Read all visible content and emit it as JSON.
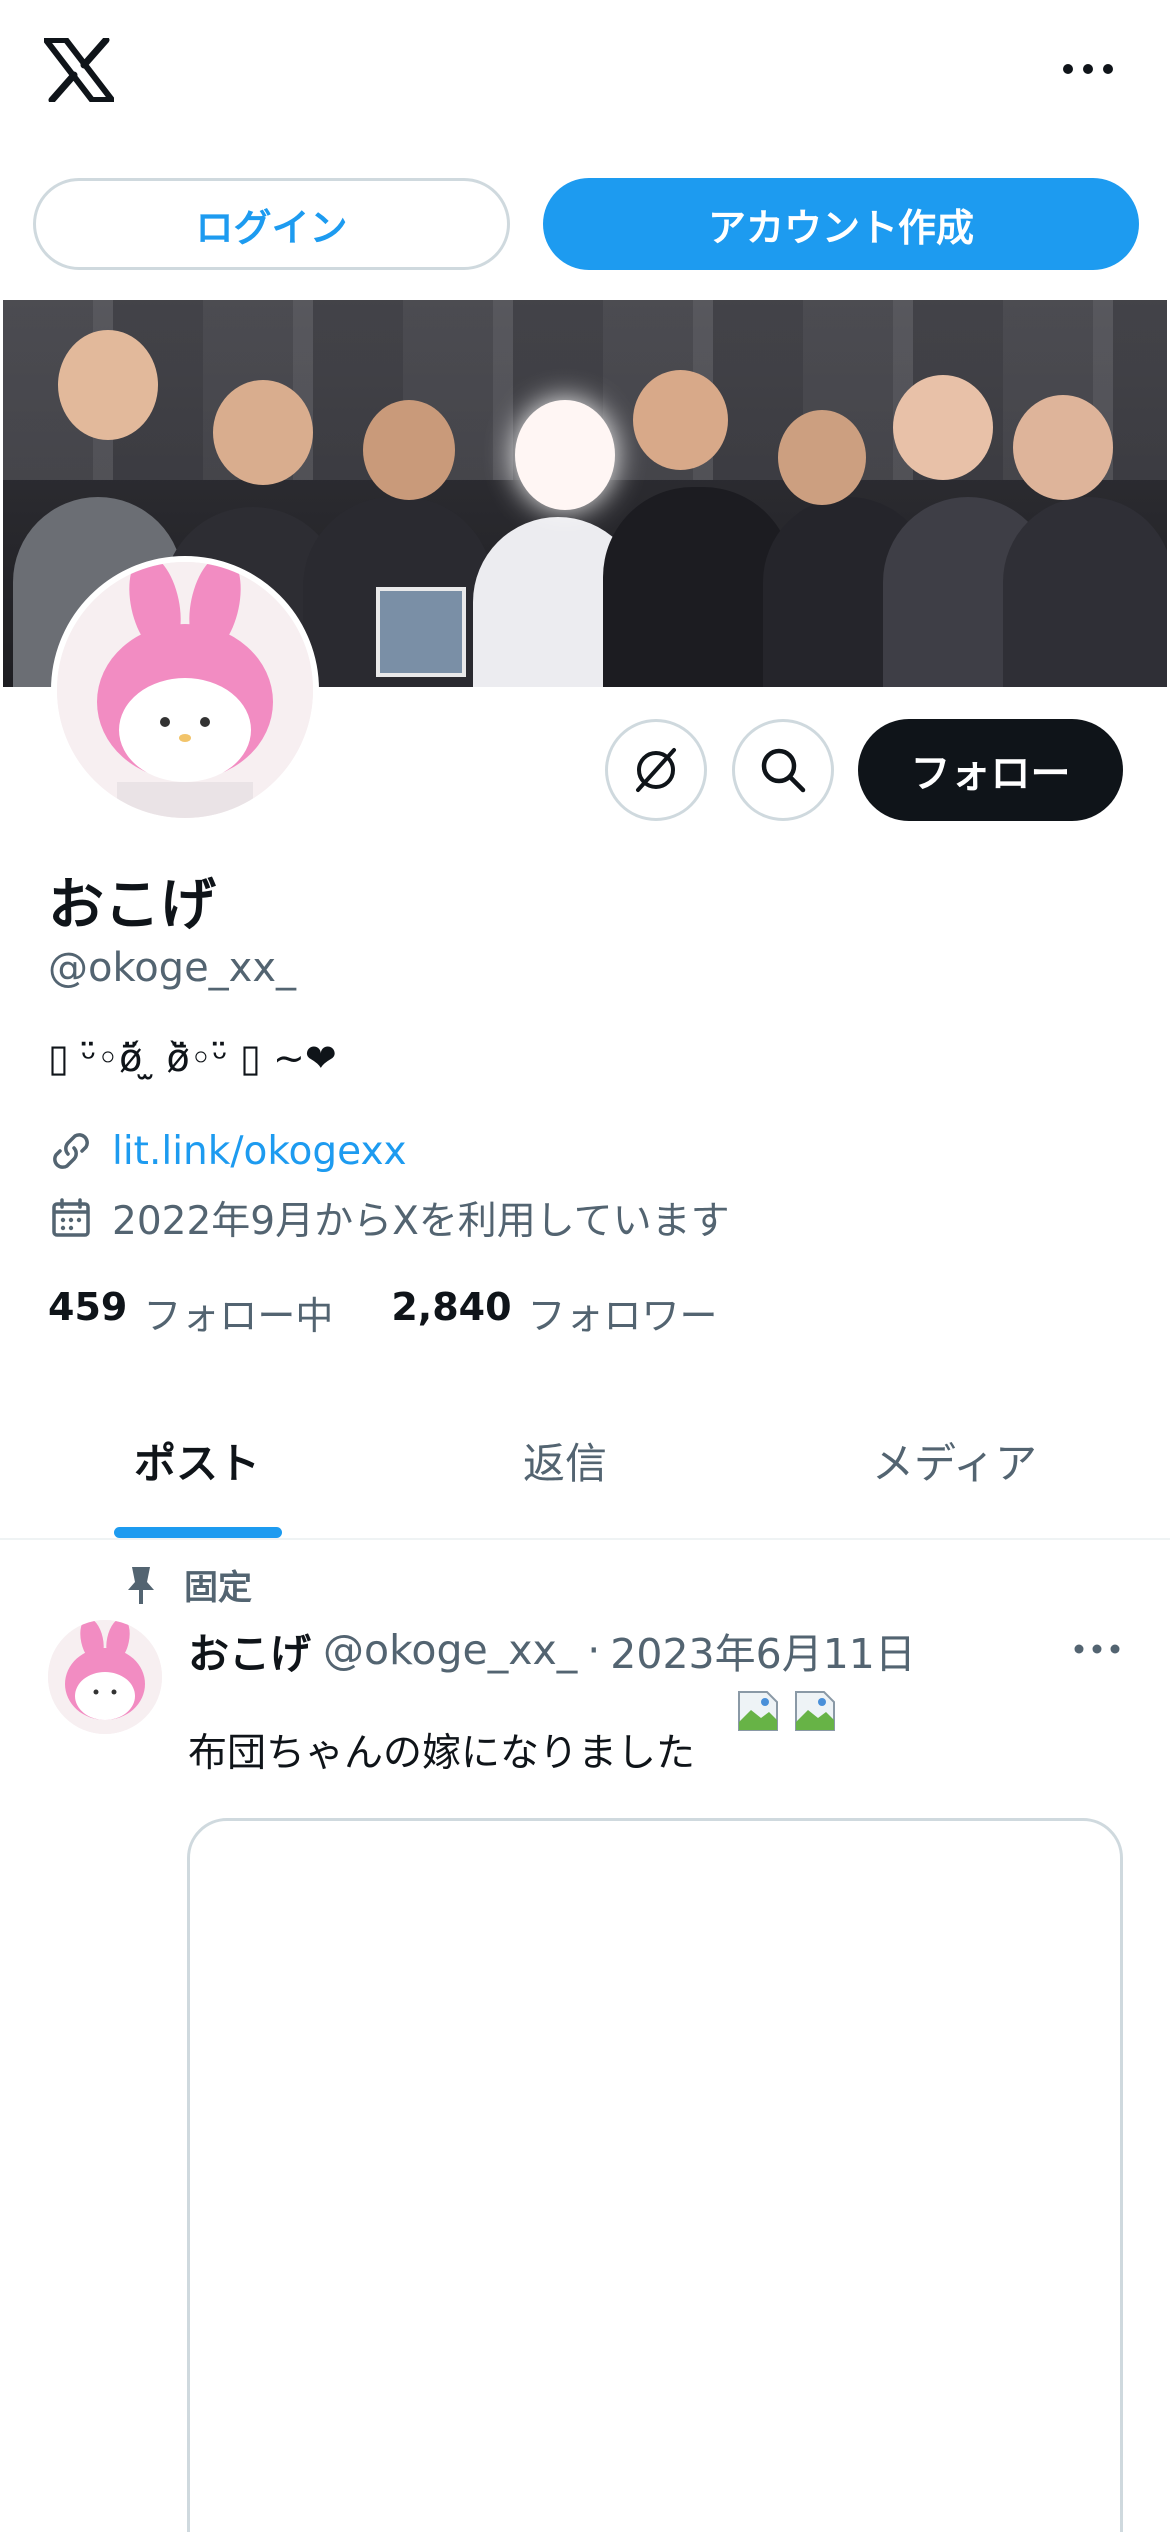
{
  "header": {
    "logo_icon": "x-logo-icon",
    "more_icon": "more-dots-icon"
  },
  "auth": {
    "login_label": "ログイン",
    "signup_label": "アカウント作成"
  },
  "profile": {
    "display_name": "おこげ",
    "handle": "@okoge_xx_",
    "bio": "▯ ᵕ̈◦ø̈᷄ ̫ ø̈᷅◦ᵕ̈ ▯ ~❤",
    "link": "lit.link/okogexx",
    "joined": "2022年9月からXを利用しています",
    "follow_label": "フォロー",
    "following_count": "459",
    "following_label": "フォロー中",
    "followers_count": "2,840",
    "followers_label": "フォロワー"
  },
  "tabs": [
    {
      "label": "ポスト",
      "selected": true
    },
    {
      "label": "返信",
      "selected": false
    },
    {
      "label": "メディア",
      "selected": false
    }
  ],
  "pinned_post": {
    "pinned_label": "固定",
    "author_name": "おこげ",
    "author_handle": "@okoge_xx_",
    "separator": "·",
    "date": "2023年6月11日",
    "text": "布団ちゃんの嫁になりました"
  },
  "colors": {
    "accent": "#1d9bf0",
    "text_primary": "#0f1419",
    "text_secondary": "#536471",
    "border": "#cfd9de",
    "follow_button": "#0f1419"
  }
}
